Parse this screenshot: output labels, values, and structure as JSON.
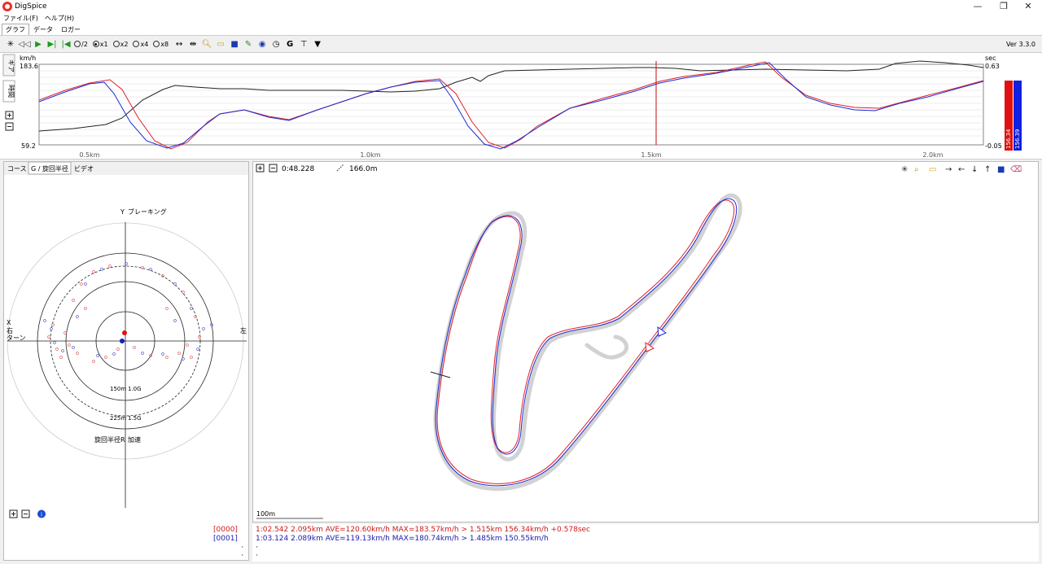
{
  "window": {
    "title": "DigSpice",
    "minimize": "—",
    "restore": "❐",
    "close": "✕"
  },
  "menu": [
    "ファイル(F)",
    "ヘルプ(H)"
  ],
  "tabs": [
    "グラフ",
    "データ",
    "ロガー"
  ],
  "toolbar": {
    "playback_options": [
      "/2",
      "x1",
      "x2",
      "x4",
      "x8"
    ],
    "selected": "x1",
    "version": "Ver 3.3.0"
  },
  "graph": {
    "left_unit": "km/h",
    "left_max": "183.6",
    "left_min": "59.2",
    "right_unit": "sec",
    "right_max": "0.63",
    "right_min": "-0.05",
    "side_tabs": [
      "ギア",
      "時間"
    ],
    "x_ticks": [
      "0.5km",
      "1.0km",
      "1.5km",
      "2.0km"
    ],
    "bar_red_label": "156.34",
    "bar_blue_label": "156.39",
    "colors": {
      "lap0": "#e0202a",
      "lap1": "#1a2bd6",
      "delta": "#222222",
      "cursor": "#c01010"
    }
  },
  "left_pane": {
    "tabs": [
      "コース",
      "G / 旋回半径",
      "ビデオ"
    ],
    "active_tab": "G / 旋回半径",
    "gcircle": {
      "y_label": "Y",
      "braking": "ブレーキング",
      "x_label": "X",
      "right_label": "右\nターン",
      "left_label": "左",
      "bottom_label": "旋回半径R",
      "accel": "加速",
      "ring1_radius": "150m",
      "ring1_g": "1.0G",
      "ring2_radius": "225m",
      "ring2_g": "1.5G"
    }
  },
  "right_pane": {
    "lap_time": "0:48.228",
    "distance": "166.0m",
    "scale_label": "100m"
  },
  "summary": {
    "rows": [
      {
        "id": "[0000]",
        "text": "1:02.542 2.095km AVE=120.60km/h MAX=183.57km/h > 1.515km 156.34km/h +0.578sec",
        "color": "#d01818"
      },
      {
        "id": "[0001]",
        "text": "1:03.124 2.089km AVE=119.13km/h MAX=180.74km/h > 1.485km 150.55km/h",
        "color": "#1a1ab0"
      }
    ],
    "dots": [
      "·",
      "·"
    ]
  }
}
